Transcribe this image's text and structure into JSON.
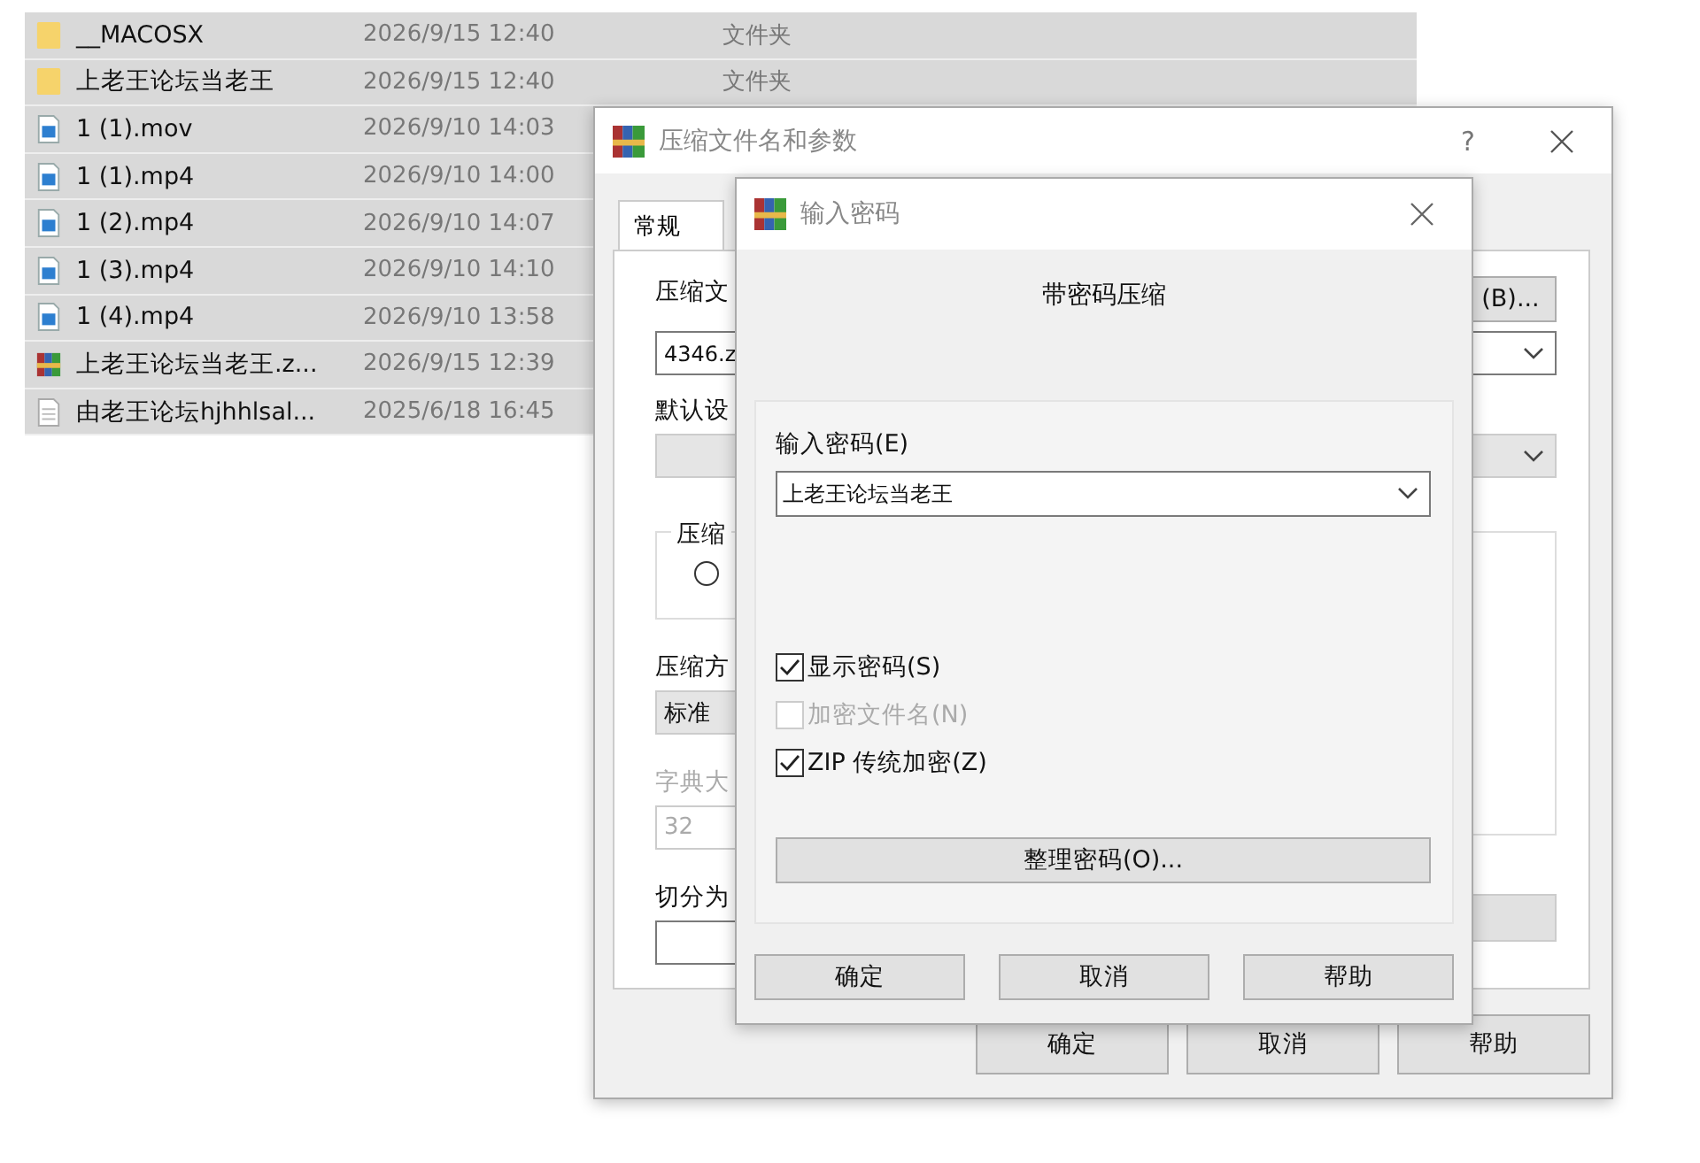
{
  "file_list": {
    "rows": [
      {
        "kind": "folder",
        "name": "__MACOSX",
        "modified": "2026/9/15 12:40",
        "type": "文件夹"
      },
      {
        "kind": "folder",
        "name": "上老王论坛当老王",
        "modified": "2026/9/15 12:40",
        "type": "文件夹"
      },
      {
        "kind": "video",
        "name": "1 (1).mov",
        "modified": "2026/9/10 14:03"
      },
      {
        "kind": "video",
        "name": "1 (1).mp4",
        "modified": "2026/9/10 14:00"
      },
      {
        "kind": "video",
        "name": "1 (2).mp4",
        "modified": "2026/9/10 14:07"
      },
      {
        "kind": "video",
        "name": "1 (3).mp4",
        "modified": "2026/9/10 14:10"
      },
      {
        "kind": "video",
        "name": "1 (4).mp4",
        "modified": "2026/9/10 13:58"
      },
      {
        "kind": "archive",
        "name": "上老王论坛当老王.z...",
        "modified": "2026/9/15 12:39"
      },
      {
        "kind": "text",
        "name": "由老王论坛hjhhlsal...",
        "modified": "2025/6/18 16:45"
      }
    ]
  },
  "archive_dialog": {
    "title": "压缩文件名和参数",
    "help": "?",
    "tabs": [
      {
        "label": "常规",
        "selected": true
      }
    ],
    "archive_name_label": "压缩文",
    "browse_button": "(B)...",
    "archive_name_value": "4346.z",
    "profile_label": "默认设",
    "format_group_label": "压缩",
    "format_radio": {
      "checked": false
    },
    "method_label": "压缩方",
    "method_value": "标准",
    "dictionary_label": "字典大",
    "dictionary_value": "32",
    "split_label": "切分为",
    "buttons": [
      "确定",
      "取消",
      "帮助"
    ]
  },
  "password_dialog": {
    "title": "输入密码",
    "heading": "带密码压缩",
    "password_label": "输入密码(E)",
    "password_value": "上老王论坛当老王",
    "options": [
      {
        "label": "显示密码(S)",
        "checked": true,
        "disabled": false
      },
      {
        "label": "加密文件名(N)",
        "checked": false,
        "disabled": true
      },
      {
        "label": "ZIP 传统加密(Z)",
        "checked": true,
        "disabled": false
      }
    ],
    "organize_button": "整理密码(O)...",
    "buttons": [
      "确定",
      "取消",
      "帮助"
    ]
  }
}
